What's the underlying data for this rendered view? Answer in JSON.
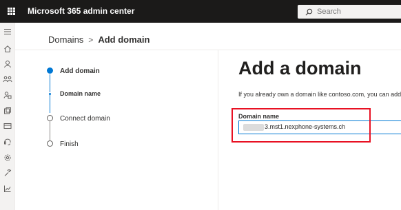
{
  "header": {
    "app_title": "Microsoft 365 admin center",
    "search_placeholder": "Search"
  },
  "rail": {
    "icons": [
      "menu-icon",
      "home-icon",
      "user-icon",
      "groups-icon",
      "roles-icon",
      "resources-icon",
      "billing-icon",
      "support-icon",
      "settings-icon",
      "setup-icon",
      "reports-icon"
    ]
  },
  "breadcrumb": {
    "parent": "Domains",
    "separator": ">",
    "current": "Add domain"
  },
  "wizard": {
    "steps": [
      {
        "label": "Add domain",
        "state": "active"
      },
      {
        "label": "Domain name",
        "state": "current-substep"
      },
      {
        "label": "Connect domain",
        "state": "pending"
      },
      {
        "label": "Finish",
        "state": "pending"
      }
    ]
  },
  "main": {
    "title": "Add a domain",
    "description": "If you already own a domain like contoso.com, you can add it to",
    "field_label": "Domain name",
    "domain_value": "3.mst1.nexphone-systems.ch"
  },
  "colors": {
    "accent": "#0078d4",
    "topbar": "#1b1a19",
    "highlight": "#e81123"
  }
}
